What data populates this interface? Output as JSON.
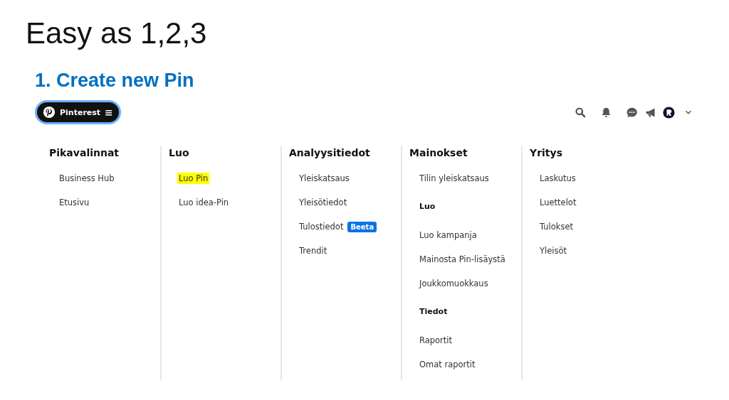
{
  "slide": {
    "title": "Easy as 1,2,3",
    "step": "1. Create new Pin"
  },
  "topbar": {
    "brand": "Pinterest",
    "menu_glyph": "≡"
  },
  "columns": [
    {
      "heading": "Pikavalinnat",
      "items": [
        {
          "kind": "link",
          "label": "Business Hub",
          "highlighted": false
        },
        {
          "kind": "link",
          "label": "Etusivu",
          "highlighted": false
        }
      ]
    },
    {
      "heading": "Luo",
      "items": [
        {
          "kind": "link",
          "label": "Luo Pin",
          "highlighted": true
        },
        {
          "kind": "link",
          "label": "Luo idea-Pin",
          "highlighted": false
        }
      ]
    },
    {
      "heading": "Analyysitiedot",
      "items": [
        {
          "kind": "link",
          "label": "Yleiskatsaus",
          "highlighted": false
        },
        {
          "kind": "link",
          "label": "Yleisötiedot",
          "highlighted": false
        },
        {
          "kind": "link",
          "label": "Tulostiedot",
          "badge": "Beeta",
          "highlighted": false
        },
        {
          "kind": "link",
          "label": "Trendit",
          "highlighted": false
        }
      ]
    },
    {
      "heading": "Mainokset",
      "items": [
        {
          "kind": "link",
          "label": "Tilin yleiskatsaus",
          "highlighted": false
        },
        {
          "kind": "subheading",
          "label": "Luo"
        },
        {
          "kind": "link",
          "label": "Luo kampanja",
          "highlighted": false
        },
        {
          "kind": "link",
          "label": "Mainosta Pin-lisäystä",
          "highlighted": false
        },
        {
          "kind": "link",
          "label": "Joukkomuokkaus",
          "highlighted": false
        },
        {
          "kind": "subheading",
          "label": "Tiedot"
        },
        {
          "kind": "link",
          "label": "Raportit",
          "highlighted": false
        },
        {
          "kind": "link",
          "label": "Omat raportit",
          "highlighted": false
        }
      ]
    },
    {
      "heading": "Yritys",
      "items": [
        {
          "kind": "link",
          "label": "Laskutus",
          "highlighted": false
        },
        {
          "kind": "link",
          "label": "Luettelot",
          "highlighted": false
        },
        {
          "kind": "link",
          "label": "Tulokset",
          "highlighted": false
        },
        {
          "kind": "link",
          "label": "Yleisöt",
          "highlighted": false
        }
      ]
    }
  ]
}
